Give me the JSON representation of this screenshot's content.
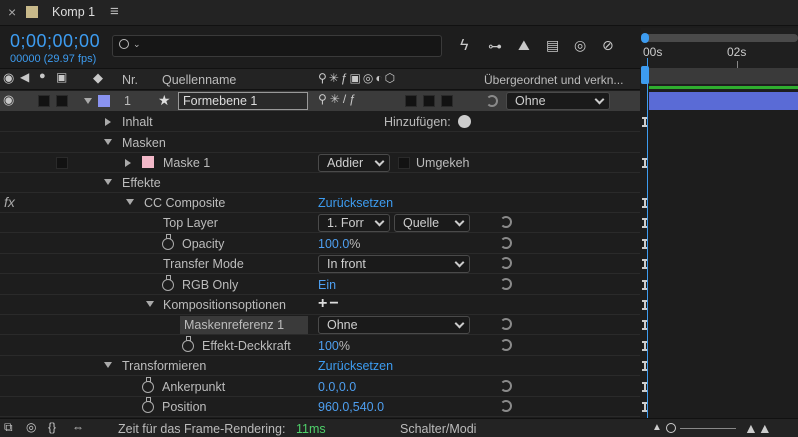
{
  "tab": {
    "close": "×",
    "title": "Komp 1",
    "menu": "≡"
  },
  "timecode": {
    "value": "0;00;00;00",
    "fps": "00000 (29.97 fps)"
  },
  "search": {
    "placeholder": ""
  },
  "timeline": {
    "start": "00s",
    "mark": "02s"
  },
  "columns": {
    "nr": "Nr.",
    "source": "Quellenname",
    "parent": "Übergeordnet und verkn..."
  },
  "layer": {
    "number": "1",
    "name": "Formebene 1",
    "parent": "Ohne"
  },
  "props": {
    "inhalt": "Inhalt",
    "add": "Hinzufügen:",
    "masken": "Masken",
    "maske1": "Maske 1",
    "mask_mode": "Addier",
    "invert": "Umgekeh",
    "effekte": "Effekte",
    "fx": "fx",
    "cc": "CC Composite",
    "reset": "Zurücksetzen",
    "top_layer": "Top Layer",
    "top_layer_val": "1. Forr",
    "top_layer_src": "Quelle",
    "opacity": "Opacity",
    "opacity_num": "100.0",
    "opacity_unit": "%",
    "transfer": "Transfer Mode",
    "transfer_val": "In front",
    "rgb": "RGB Only",
    "rgb_val": "Ein",
    "komp": "Kompositionsoptionen",
    "komp_ctl": "+−",
    "maskref": "Maskenreferenz 1",
    "maskref_val": "Ohne",
    "deck": "Effekt-Deckkraft",
    "deck_num": "100",
    "deck_unit": "%",
    "transform": "Transformieren",
    "reset2": "Zurücksetzen",
    "anchor": "Ankerpunkt",
    "anchor_val": "0.0,0.0",
    "position": "Position",
    "position_val": "960.0,540.0"
  },
  "status": {
    "render_label": "Zeit für das Frame-Rendering:",
    "render_val": "11ms",
    "switches": "Schalter/Modi"
  },
  "colors": {
    "accent": "#3d9cf0",
    "label": "#8a93f0",
    "mask_swatch": "#f2b8c8",
    "work_area": "#5a6bd6"
  }
}
